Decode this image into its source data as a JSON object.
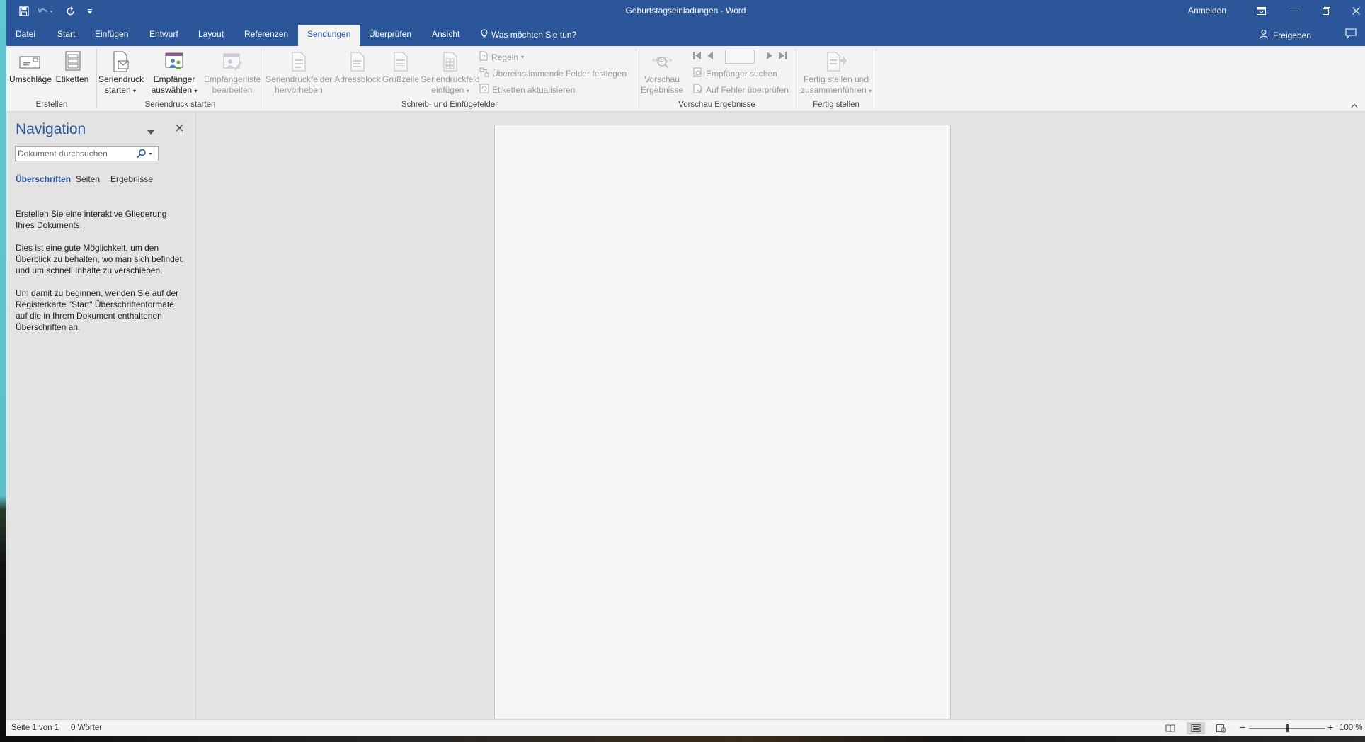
{
  "titlebar": {
    "document_title": "Geburtstagseinladungen  -  Word",
    "sign_in": "Anmelden",
    "qat_icons": [
      "save-icon",
      "undo-icon",
      "redo-icon",
      "customize-qat-icon"
    ],
    "window_icons": [
      "ribbon-display-options-icon",
      "minimize-icon",
      "restore-icon",
      "close-icon"
    ]
  },
  "tabs": {
    "items": [
      "Datei",
      "Start",
      "Einfügen",
      "Entwurf",
      "Layout",
      "Referenzen",
      "Sendungen",
      "Überprüfen",
      "Ansicht"
    ],
    "active": "Sendungen",
    "tell_me": "Was möchten Sie tun?",
    "share": "Freigeben"
  },
  "ribbon": {
    "groups": {
      "create": "Erstellen",
      "start_merge": "Seriendruck starten",
      "write_insert": "Schreib- und Einfügefelder",
      "preview": "Vorschau Ergebnisse",
      "finish": "Fertig stellen"
    },
    "envelopes": "Umschläge",
    "labels": "Etiketten",
    "start_merge_l1": "Seriendruck",
    "start_merge_l2": "starten",
    "select_recipients_l1": "Empfänger",
    "select_recipients_l2": "auswählen",
    "edit_list_l1": "Empfängerliste",
    "edit_list_l2": "bearbeiten",
    "highlight_l1": "Seriendruckfelder",
    "highlight_l2": "hervorheben",
    "address_block": "Adressblock",
    "greeting_line": "Grußzeile",
    "insert_field_l1": "Seriendruckfeld",
    "insert_field_l2": "einfügen",
    "rules": "Regeln",
    "match_fields": "Übereinstimmende Felder festlegen",
    "update_labels": "Etiketten aktualisieren",
    "preview_l1": "Vorschau",
    "preview_l2": "Ergebnisse",
    "find_recipient": "Empfänger suchen",
    "check_errors": "Auf Fehler überprüfen",
    "record_number": "",
    "finish_l1": "Fertig stellen und",
    "finish_l2": "zusammenführen"
  },
  "navigation": {
    "title": "Navigation",
    "search_placeholder": "Dokument durchsuchen",
    "tabs": [
      "Überschriften",
      "Seiten",
      "Ergebnisse"
    ],
    "active_tab": "Überschriften",
    "help_paragraphs": [
      "Erstellen Sie eine interaktive Gliederung Ihres Dokuments.",
      "Dies ist eine gute Möglichkeit, um den Überblick zu behalten, wo man sich befindet, und um schnell Inhalte zu verschieben.",
      "Um damit zu beginnen, wenden Sie auf der Registerkarte \"Start\" Überschriftenformate auf die in Ihrem Dokument enthaltenen Überschriften an."
    ]
  },
  "statusbar": {
    "page": "Seite 1 von 1",
    "words": "0 Wörter",
    "zoom": "100 %",
    "zoom_level_percent": 100,
    "active_view": "Seitenlayout"
  },
  "colors": {
    "accent": "#2b579a",
    "ribbon_bg": "#f3f3f3",
    "workspace_bg": "#e3e3e3",
    "disabled_text": "#9c9c9c"
  }
}
